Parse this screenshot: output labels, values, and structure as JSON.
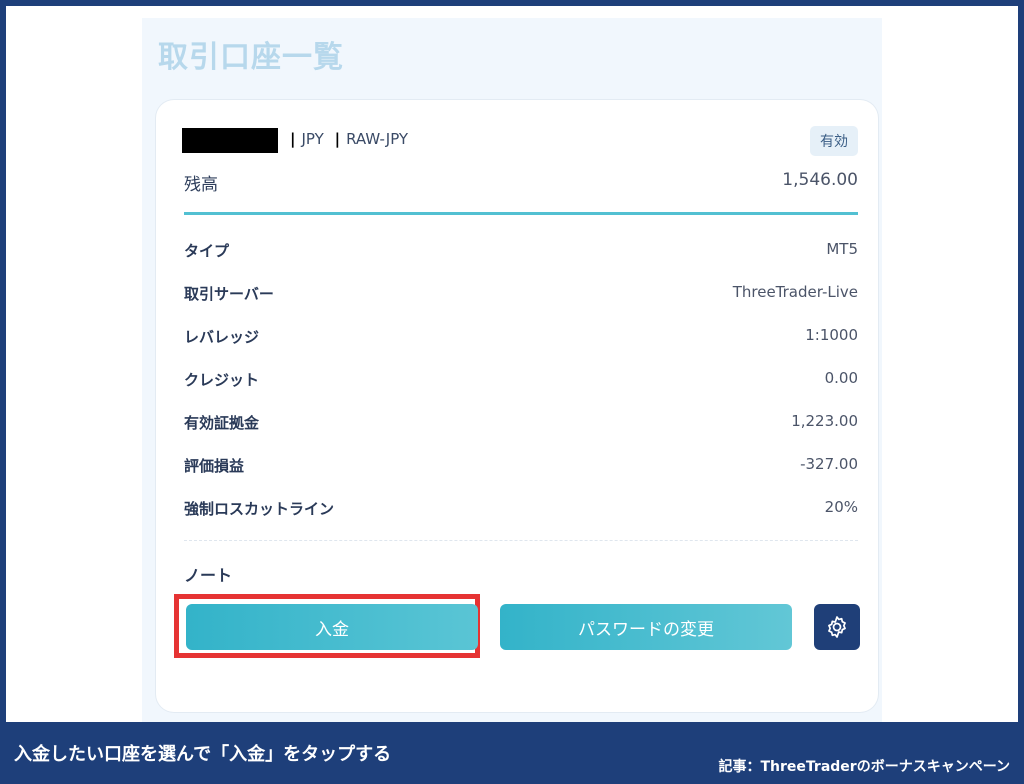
{
  "page": {
    "title": "取引口座一覧"
  },
  "account": {
    "currency": "JPY",
    "account_type": "RAW-JPY",
    "status": "有効",
    "balance_label": "残高",
    "balance_value": "1,546.00"
  },
  "details": [
    {
      "label": "タイプ",
      "value": "MT5"
    },
    {
      "label": "取引サーバー",
      "value": "ThreeTrader-Live"
    },
    {
      "label": "レバレッジ",
      "value": "1:1000"
    },
    {
      "label": "クレジット",
      "value": "0.00"
    },
    {
      "label": "有効証拠金",
      "value": "1,223.00"
    },
    {
      "label": "評価損益",
      "value": "-327.00"
    },
    {
      "label": "強制ロスカットライン",
      "value": "20%"
    }
  ],
  "note_label": "ノート",
  "buttons": {
    "deposit": "入金",
    "change_password": "パスワードの変更",
    "settings_icon": "gear-icon"
  },
  "footer": {
    "caption": "入金したい口座を選んで「入金」をタップする",
    "source": "記事：ThreeTraderのボーナスキャンペーン"
  },
  "colors": {
    "frame": "#1e3f7a",
    "accent": "#33b3c9",
    "highlight": "#e63333",
    "settings_bg": "#1f3f78"
  }
}
